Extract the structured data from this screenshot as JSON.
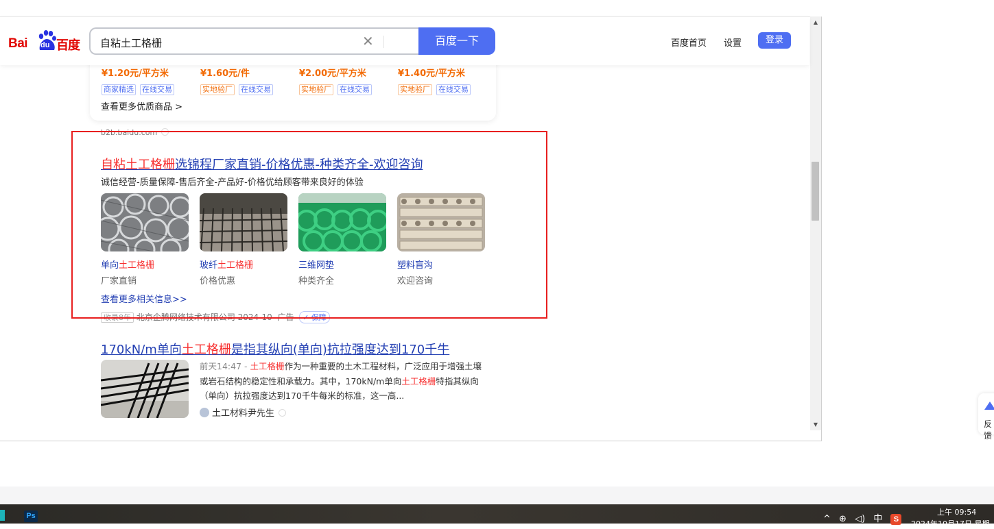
{
  "header": {
    "logo_bai": "Bai",
    "logo_du": "du",
    "logo_cn": "百度",
    "search_value": "自粘土工格栅",
    "search_button": "百度一下",
    "nav_home": "百度首页",
    "nav_settings": "设置",
    "nav_login": "登录"
  },
  "products": [
    {
      "price": "¥1.20元/平方米",
      "tags": [
        {
          "text": "商家精选",
          "color": "blue"
        },
        {
          "text": "在线交易",
          "color": "blue"
        }
      ]
    },
    {
      "price": "¥1.60元/件",
      "tags": [
        {
          "text": "实地验厂",
          "color": "orange"
        },
        {
          "text": "在线交易",
          "color": "blue"
        }
      ]
    },
    {
      "price": "¥2.00元/平方米",
      "tags": [
        {
          "text": "实地验厂",
          "color": "orange"
        },
        {
          "text": "在线交易",
          "color": "blue"
        }
      ]
    },
    {
      "price": "¥1.40元/平方米",
      "tags": [
        {
          "text": "实地验厂",
          "color": "orange"
        },
        {
          "text": "在线交易",
          "color": "blue"
        }
      ]
    }
  ],
  "more_products": "查看更多优质商品 >",
  "b2b_source": "b2b.baidu.com",
  "ad": {
    "title_highlight": "自粘土工格栅",
    "title_rest": "选锦程厂家直销-价格优惠-种类齐全-欢迎咨询",
    "description": "诚信经营-质量保障-售后齐全-产品好-价格优给顾客带来良好的体验",
    "items": [
      {
        "caption_pre": "单向",
        "caption_hl": "土工格栅",
        "sub": "厂家直销"
      },
      {
        "caption_pre": "玻纤",
        "caption_hl": "土工格栅",
        "sub": "价格优惠"
      },
      {
        "caption_pre": "三维网垫",
        "caption_hl": "",
        "sub": "种类齐全"
      },
      {
        "caption_pre": "塑料盲沟",
        "caption_hl": "",
        "sub": "欢迎咨询"
      }
    ],
    "more_info": "查看更多相关信息>>",
    "footer_tag": "收录8年",
    "footer_company": "北京企腾网络技术有限公司 2024-10",
    "footer_ad": "广告",
    "footer_guard": "保障"
  },
  "result2": {
    "title_pre": "170kN/m单向",
    "title_hl": "土工格栅",
    "title_rest": "是指其纵向(单向)抗拉强度达到170千牛",
    "time": "前天14:47 - ",
    "snippet_hl1": "土工格栅",
    "snippet_1": "作为一种重要的土木工程材料，广泛应用于增强土壤或岩石结构的稳定性和承载力。其中，170kN/m单向",
    "snippet_hl2": "土工格栅",
    "snippet_2": "特指其纵向（单向）抗拉强度达到170千牛每米的标准，这一高...",
    "source": "土工材料尹先生"
  },
  "feedback_label": "反馈",
  "taskbar": {
    "ps_label": "Ps",
    "tray_caret": "^",
    "tray_lang": "中",
    "sogou": "S",
    "time": "上午 09:54",
    "date": "2024年10月17日 星期"
  },
  "colors": {
    "baidu_blue": "#4e6ef2",
    "link_blue": "#2440b3",
    "highlight_red": "#f73131",
    "price_orange": "#f26a04",
    "annotation_red": "#e81f1f"
  }
}
